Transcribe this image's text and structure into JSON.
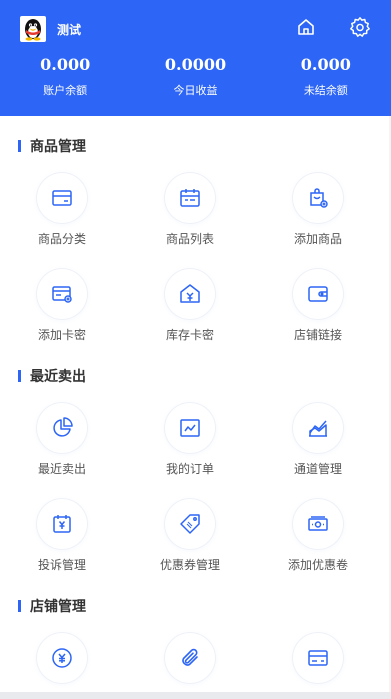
{
  "header": {
    "username": "测试",
    "home_icon": "home-icon",
    "settings_icon": "gear-icon",
    "background": "#2d66f6"
  },
  "stats": [
    {
      "value": "0.000",
      "label": "账户余额"
    },
    {
      "value": "0.0000",
      "label": "今日收益"
    },
    {
      "value": "0.000",
      "label": "未结余额"
    }
  ],
  "sections": [
    {
      "title": "商品管理",
      "items": [
        {
          "label": "商品分类",
          "icon": "category-card-icon"
        },
        {
          "label": "商品列表",
          "icon": "calendar-list-icon"
        },
        {
          "label": "添加商品",
          "icon": "shopping-bag-add-icon"
        },
        {
          "label": "添加卡密",
          "icon": "card-add-icon"
        },
        {
          "label": "库存卡密",
          "icon": "warehouse-icon"
        },
        {
          "label": "店铺链接",
          "icon": "wallet-link-icon"
        }
      ]
    },
    {
      "title": "最近卖出",
      "items": [
        {
          "label": "最近卖出",
          "icon": "pie-chart-icon"
        },
        {
          "label": "我的订单",
          "icon": "line-chart-icon"
        },
        {
          "label": "通道管理",
          "icon": "area-chart-icon"
        },
        {
          "label": "投诉管理",
          "icon": "yen-calendar-icon"
        },
        {
          "label": "优惠券管理",
          "icon": "coupon-tag-icon"
        },
        {
          "label": "添加优惠卷",
          "icon": "cash-icon"
        }
      ]
    },
    {
      "title": "店铺管理",
      "items": [
        {
          "label": "",
          "icon": "yen-circle-icon"
        },
        {
          "label": "",
          "icon": "paperclip-icon"
        },
        {
          "label": "",
          "icon": "bank-card-icon"
        }
      ]
    }
  ],
  "accent": "#2d66f6"
}
